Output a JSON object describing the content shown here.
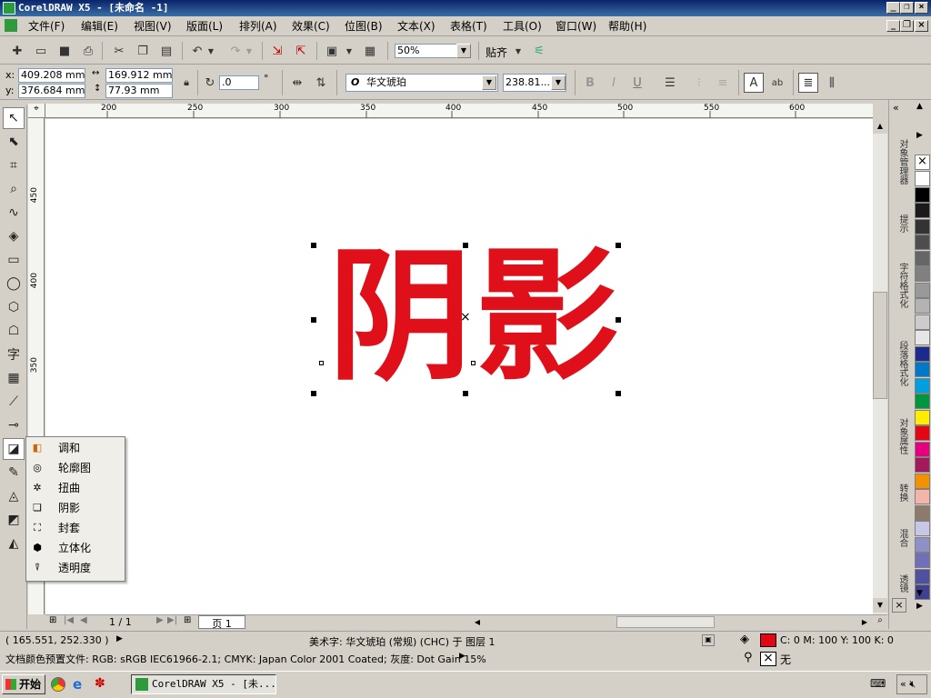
{
  "window": {
    "title": "CorelDRAW X5 - [未命名 -1]"
  },
  "menu": {
    "items": [
      "文件(F)",
      "编辑(E)",
      "视图(V)",
      "版面(L)",
      "排列(A)",
      "效果(C)",
      "位图(B)",
      "文本(X)",
      "表格(T)",
      "工具(O)",
      "窗口(W)",
      "帮助(H)"
    ]
  },
  "standard_toolbar": {
    "zoom": "50%",
    "snap_label": "贴齐"
  },
  "property_bar": {
    "x_label": "x:",
    "x_value": "409.208 mm",
    "y_label": "y:",
    "y_value": "376.684 mm",
    "width_value": "169.912 mm",
    "height_value": "77.93 mm",
    "rotation_value": ".0",
    "degree_symbol": "°",
    "font_name": "华文琥珀",
    "font_size": "238.81..."
  },
  "ruler": {
    "top_ticks": [
      "200",
      "250",
      "300",
      "350",
      "400",
      "450",
      "500",
      "550",
      "600"
    ],
    "left_ticks": [
      "450",
      "400",
      "350"
    ]
  },
  "canvas": {
    "artwork_text": "阴影",
    "artwork_color": "#e0101a"
  },
  "flyout": {
    "items": [
      {
        "label": "调和",
        "icon": "blend-icon"
      },
      {
        "label": "轮廓图",
        "icon": "contour-icon"
      },
      {
        "label": "扭曲",
        "icon": "distort-icon"
      },
      {
        "label": "阴影",
        "icon": "drop-shadow-icon"
      },
      {
        "label": "封套",
        "icon": "envelope-icon"
      },
      {
        "label": "立体化",
        "icon": "extrude-icon"
      },
      {
        "label": "透明度",
        "icon": "transparency-icon"
      }
    ]
  },
  "page_nav": {
    "page_count": "1 / 1",
    "page_tab": "页 1"
  },
  "docker": {
    "tabs": [
      "对象管理器",
      "提示",
      "字符格式化",
      "段落格式化",
      "对象属性",
      "转换",
      "混合",
      "透镜"
    ]
  },
  "palette": {
    "colors": [
      "#ffffff",
      "#000000",
      "#1a1a1a",
      "#333333",
      "#4d4d4d",
      "#666666",
      "#808080",
      "#999999",
      "#b3b3b3",
      "#cccccc",
      "#e6e6e6",
      "#1c2a8c",
      "#0078c8",
      "#00a0e0",
      "#009640",
      "#ffed00",
      "#e30613",
      "#e6007e",
      "#a3195b",
      "#f39200",
      "#f5b4a8",
      "#8c7a6b",
      "#c8c8e6",
      "#9090c8",
      "#7070b8",
      "#5050a0",
      "#404090"
    ]
  },
  "status": {
    "coords": "( 165.551, 252.330 )",
    "object_info": "美术字: 华文琥珀 (常规) (CHC) 于 图层 1",
    "fill_values": "C: 0 M: 100 Y: 100 K: 0",
    "outline_value": "无",
    "color_profile": "文档颜色预置文件: RGB: sRGB IEC61966-2.1; CMYK: Japan Color 2001 Coated; 灰度: Dot Gain 15%",
    "fill_color": "#e30613"
  },
  "taskbar": {
    "start_label": "开始",
    "task_label": "CorelDRAW X5 - [未..."
  }
}
